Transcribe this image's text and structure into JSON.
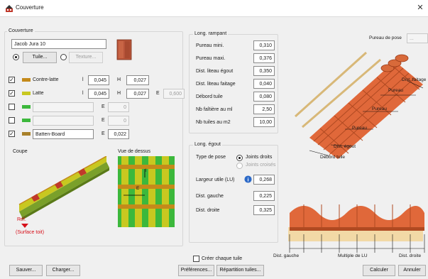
{
  "window": {
    "title": "Couverture",
    "close_glyph": "✕"
  },
  "couverture": {
    "group_label": "Couverture",
    "name_value": "Jacob Jura 10",
    "tuile_label": "Tuile...",
    "texture_label": "Texture..."
  },
  "layers": [
    {
      "checked": true,
      "name": "Contre-latte",
      "color": "#c48a1a",
      "f1": "l",
      "v1": "0,045",
      "f2": "H",
      "v2": "0,027"
    },
    {
      "checked": true,
      "name": "Latte",
      "color": "#c8c820",
      "f1": "l",
      "v1": "0,045",
      "f2": "H",
      "v2": "0,027",
      "f3": "E",
      "v3": "0,600"
    },
    {
      "checked": false,
      "name": "",
      "color": "#3cb83c",
      "f1": "E",
      "v1": "0"
    },
    {
      "checked": false,
      "name": "",
      "color": "#3cb83c",
      "f1": "E",
      "v1": "0"
    },
    {
      "checked": true,
      "name": "Batten-Board",
      "color": "#a8802a",
      "f1": "E",
      "v1": "0,022"
    }
  ],
  "previews": {
    "coupe_label": "Coupe",
    "dessus_label": "Vue de dessus",
    "l_marker": "l",
    "e_marker": "E",
    "ref_label": "Réf.",
    "surface_label": "(Surface toit)"
  },
  "rampant": {
    "group_label": "Long. rampant",
    "rows": [
      {
        "label": "Pureau mini.",
        "value": "0,310"
      },
      {
        "label": "Pureau maxi.",
        "value": "0,376"
      },
      {
        "label": "Dist. liteau égout",
        "value": "0,350"
      },
      {
        "label": "Dist. liteau faitage",
        "value": "0,040"
      },
      {
        "label": "Débord tuile",
        "value": "0,080"
      },
      {
        "label": "Nb faîtière au ml",
        "value": "2,50"
      },
      {
        "label": "Nb tuiles au m2",
        "value": "10,00"
      }
    ]
  },
  "egout": {
    "group_label": "Long. égout",
    "type_label": "Type de pose",
    "opt1": "Joints droits",
    "opt2": "Joints croisés",
    "largeur_label": "Largeur utile (LU)",
    "largeur_value": "0,268",
    "gauche_label": "Dist. gauche",
    "gauche_value": "0,225",
    "droite_label": "Dist. droite",
    "droite_value": "0,325"
  },
  "creer_label": "Créer chaque tuile",
  "illus_top": {
    "pureau_pose_label": "Pureau de pose",
    "pureau_pose_value": "...",
    "dist_faitage": "Dist. faitage",
    "pureau": "Pureau",
    "dist_egout": "Dist. égout",
    "debord": "Débord tuile"
  },
  "illus_bottom": {
    "dist_gauche": "Dist. gauche",
    "multiple": "Multiple de LU",
    "dist_droite": "Dist. droite"
  },
  "footer": {
    "sauver": "Sauver...",
    "charger": "Charger...",
    "preferences": "Préférences...",
    "repartition": "Répartition tuiles...",
    "calculer": "Calculer",
    "annuler": "Annuler"
  }
}
